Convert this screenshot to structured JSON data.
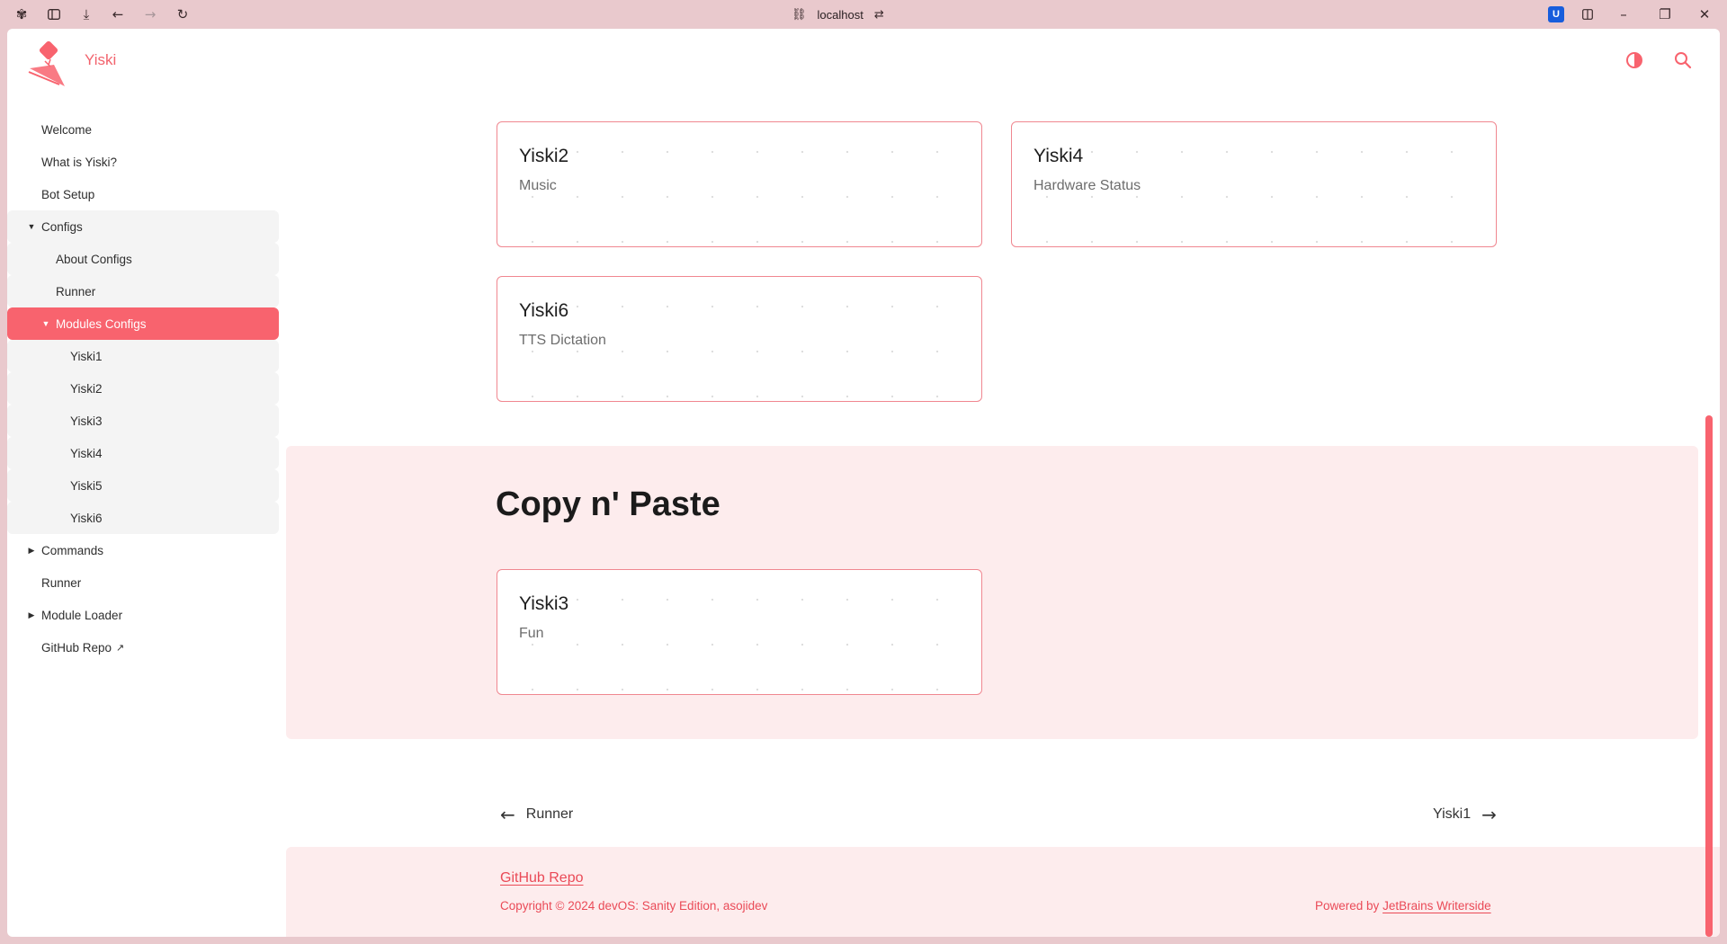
{
  "browser": {
    "url": "localhost",
    "icons": [
      "extensions-icon",
      "sidebar-toggle-icon",
      "download-icon",
      "back-icon",
      "forward-icon",
      "reload-icon",
      "link-icon",
      "site-settings-icon",
      "bitwarden-icon",
      "split-view-icon",
      "minimize-icon",
      "restore-icon",
      "close-icon"
    ]
  },
  "header": {
    "brand": "Yiski",
    "icons": [
      "theme-toggle-icon",
      "search-icon"
    ],
    "accent": "#f8636e"
  },
  "sidebar": {
    "items": [
      {
        "label": "Welcome"
      },
      {
        "label": "What is Yiski?"
      },
      {
        "label": "Bot Setup"
      },
      {
        "label": "Configs",
        "expanded": true
      },
      {
        "label": "About Configs"
      },
      {
        "label": "Runner"
      },
      {
        "label": "Modules Configs",
        "expanded": true,
        "active": true
      },
      {
        "label": "Yiski1"
      },
      {
        "label": "Yiski2"
      },
      {
        "label": "Yiski3"
      },
      {
        "label": "Yiski4"
      },
      {
        "label": "Yiski5"
      },
      {
        "label": "Yiski6"
      },
      {
        "label": "Commands",
        "expanded": false
      },
      {
        "label": "Runner"
      },
      {
        "label": "Module Loader",
        "expanded": false
      },
      {
        "label": "GitHub Repo",
        "external": "↗"
      }
    ]
  },
  "main": {
    "cards": [
      {
        "title": "Yiski2",
        "subtitle": "Music"
      },
      {
        "title": "Yiski4",
        "subtitle": "Hardware Status"
      },
      {
        "title": "Yiski6",
        "subtitle": "TTS Dictation"
      }
    ],
    "section": {
      "title": "Copy n' Paste",
      "cards": [
        {
          "title": "Yiski3",
          "subtitle": "Fun"
        }
      ]
    },
    "prev": {
      "label": "Runner"
    },
    "next": {
      "label": "Yiski1"
    }
  },
  "footer": {
    "repo_link": "GitHub Repo",
    "copyright": "Copyright © 2024 devOS: Sanity Edition, asojidev",
    "powered_prefix": "Powered by",
    "powered_link": "JetBrains Writerside"
  }
}
